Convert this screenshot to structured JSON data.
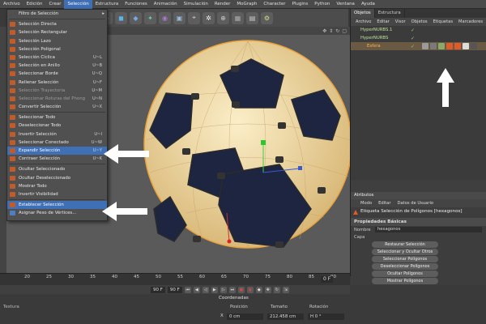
{
  "menubar": {
    "items": [
      "Archivo",
      "Edición",
      "Crear",
      "Selección",
      "Estructura",
      "Funciones",
      "Animación",
      "Simulación",
      "Render",
      "MoGraph",
      "Character",
      "Plugins",
      "Python",
      "Ventana",
      "Ayuda"
    ],
    "active_index": 3
  },
  "selection_menu": {
    "items": [
      {
        "label": "Filtro de Selección",
        "shortcut": "",
        "icon": "none",
        "submenu": true
      },
      {
        "label": "Selección Directa",
        "shortcut": "",
        "icon": "orange"
      },
      {
        "label": "Selección Rectangular",
        "shortcut": "",
        "icon": "orange"
      },
      {
        "label": "Selección Lazo",
        "shortcut": "",
        "icon": "orange"
      },
      {
        "label": "Selección Poligonal",
        "shortcut": "",
        "icon": "orange"
      },
      {
        "label": "Selección Cíclica",
        "shortcut": "U~L",
        "icon": "orange"
      },
      {
        "label": "Selección en Anillo",
        "shortcut": "U~B",
        "icon": "orange"
      },
      {
        "label": "Seleccionar Borde",
        "shortcut": "U~Q",
        "icon": "orange"
      },
      {
        "label": "Rellenar Selección",
        "shortcut": "U~F",
        "icon": "orange"
      },
      {
        "label": "Selección Trayectoria",
        "shortcut": "U~M",
        "icon": "orange",
        "dim": true
      },
      {
        "label": "Seleccionar Roturas del Phong",
        "shortcut": "U~N",
        "icon": "orange",
        "dim": true
      },
      {
        "label": "Convertir Selección",
        "shortcut": "U~X",
        "icon": "orange"
      },
      {
        "label": "Seleccionar Todo",
        "shortcut": "",
        "icon": "orange"
      },
      {
        "label": "Deseleccionar Todo",
        "shortcut": "",
        "icon": "orange"
      },
      {
        "label": "Invertir Selección",
        "shortcut": "U~I",
        "icon": "orange"
      },
      {
        "label": "Seleccionar Conectado",
        "shortcut": "U~W",
        "icon": "orange"
      },
      {
        "label": "Expandir Selección",
        "shortcut": "U~Y",
        "icon": "orange",
        "highlight": true
      },
      {
        "label": "Contraer Selección",
        "shortcut": "U~K",
        "icon": "orange"
      },
      {
        "label": "Ocultar Seleccionado",
        "shortcut": "",
        "icon": "orange"
      },
      {
        "label": "Ocultar Deseleccionado",
        "shortcut": "",
        "icon": "orange"
      },
      {
        "label": "Mostrar Todo",
        "shortcut": "",
        "icon": "orange"
      },
      {
        "label": "Invertir Visibilidad",
        "shortcut": "",
        "icon": "orange"
      },
      {
        "label": "Establecer Selección",
        "shortcut": "",
        "icon": "orange",
        "highlight": true
      },
      {
        "label": "Asignar Peso de Vértices...",
        "shortcut": "",
        "icon": "blue"
      }
    ],
    "separators_after": [
      0,
      11,
      17,
      21
    ]
  },
  "objects_panel": {
    "tabs": [
      "Objetos",
      "Estructura"
    ],
    "menu": [
      "Archivo",
      "Editar",
      "Visor",
      "Objetos",
      "Etiquetas",
      "Marcadores"
    ],
    "rows": [
      {
        "name": "HyperNURBS.1",
        "indent": 1
      },
      {
        "name": "HyperNURBS",
        "indent": 1
      },
      {
        "name": "Esfera",
        "indent": 2,
        "selected": true
      }
    ]
  },
  "attributes_panel": {
    "tab": "Atributos",
    "menu": [
      "Modo",
      "Editar",
      "Datos de Usuario"
    ],
    "title": "Etiqueta Selección de Polígonos [hexagonos]",
    "section": "Propiedades Básicas",
    "name_label": "Nombre",
    "name_value": "hexagonos",
    "caps_label": "Capa",
    "buttons": [
      "Restaurar Selección",
      "Seleccionar y Ocultar Otros",
      "Seleccionar Polígonos",
      "Deseleccionar Polígonos",
      "Ocultar Polígonos",
      "Mostrar Polígonos"
    ]
  },
  "timeline": {
    "ticks": [
      "20",
      "25",
      "30",
      "35",
      "40",
      "45",
      "50",
      "55",
      "60",
      "65",
      "70",
      "75",
      "80",
      "85",
      "90"
    ],
    "frame_left": "0 F",
    "frame_mid": "90 F",
    "frame_right": "0 F",
    "frame_start": "90 F"
  },
  "coords": {
    "title": "Coordenadas",
    "headers": [
      "Posición",
      "Tamaño",
      "Rotación"
    ],
    "x_label": "X",
    "pos_x": "0 cm",
    "size_x": "212.458 cm",
    "rot_h": "H  0 °",
    "textura": "Textura"
  },
  "colors": {
    "accent": "#3f6fb5",
    "ball_patch": "#f2d9a0",
    "ball_pentagon": "#1d2540",
    "menu_bg": "#505050"
  }
}
